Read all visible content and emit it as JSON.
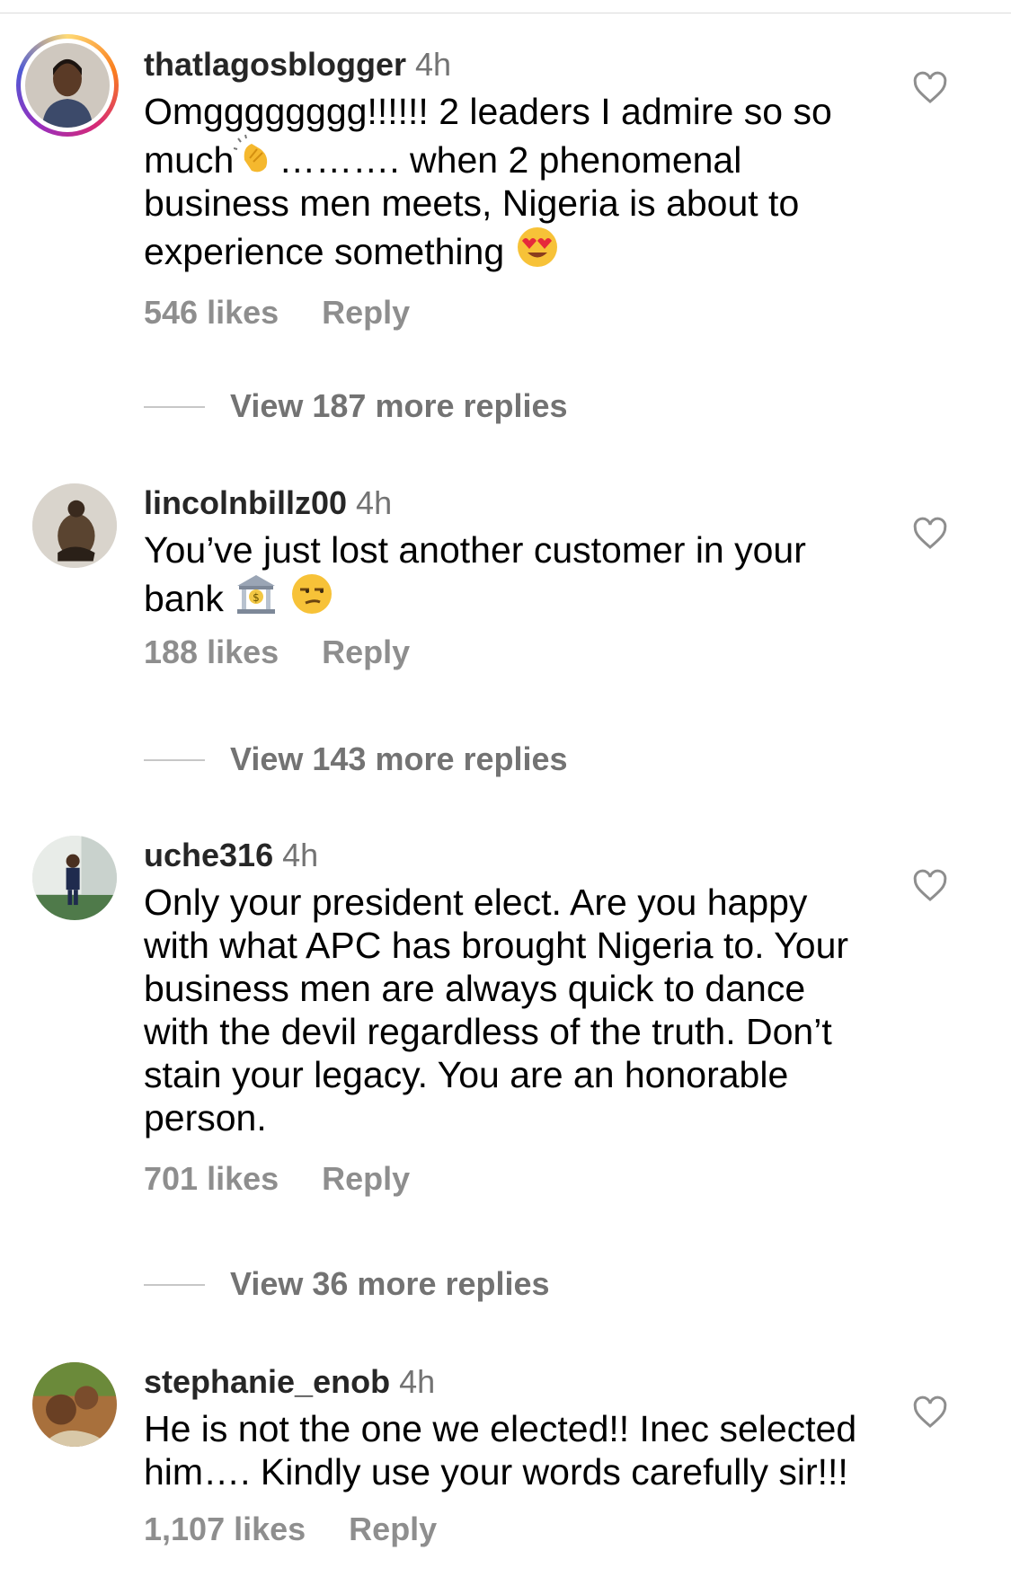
{
  "comments": [
    {
      "username": "thatlagosblogger",
      "time": "4h",
      "text_parts": [
        "Omgggggggg!!!!!! 2 leaders I admire so so much",
        "………. when 2 phenomenal business men meets, Nigeria is about to experience something "
      ],
      "emojis": [
        "clapping-hands-emoji",
        "heart-eyes-emoji"
      ],
      "likes": "546 likes",
      "reply": "Reply",
      "view_replies": "View 187 more replies"
    },
    {
      "username": "lincolnbillz00",
      "time": "4h",
      "text_parts": [
        "You’ve just lost another customer in your bank "
      ],
      "emojis": [
        "bank-emoji",
        "unamused-face-emoji"
      ],
      "likes": "188 likes",
      "reply": "Reply",
      "view_replies": "View 143 more replies"
    },
    {
      "username": "uche316",
      "time": "4h",
      "text": "Only your president elect. Are you happy with what APC has brought Nigeria to. Your business men are always quick to dance with the devil regardless of the truth. Don’t stain your legacy. You are an honorable person.",
      "likes": "701 likes",
      "reply": "Reply",
      "view_replies": "View 36 more replies"
    },
    {
      "username": "stephanie_enob",
      "time": "4h",
      "text": "He is not the one we elected!! Inec selected him…. Kindly use your words carefully sir!!!",
      "likes": "1,107 likes",
      "reply": "Reply"
    }
  ],
  "icons": {
    "like": "heart-outline-icon"
  },
  "colors": {
    "username": "#262626",
    "meta": "#737373",
    "action": "#8e8e8e"
  }
}
